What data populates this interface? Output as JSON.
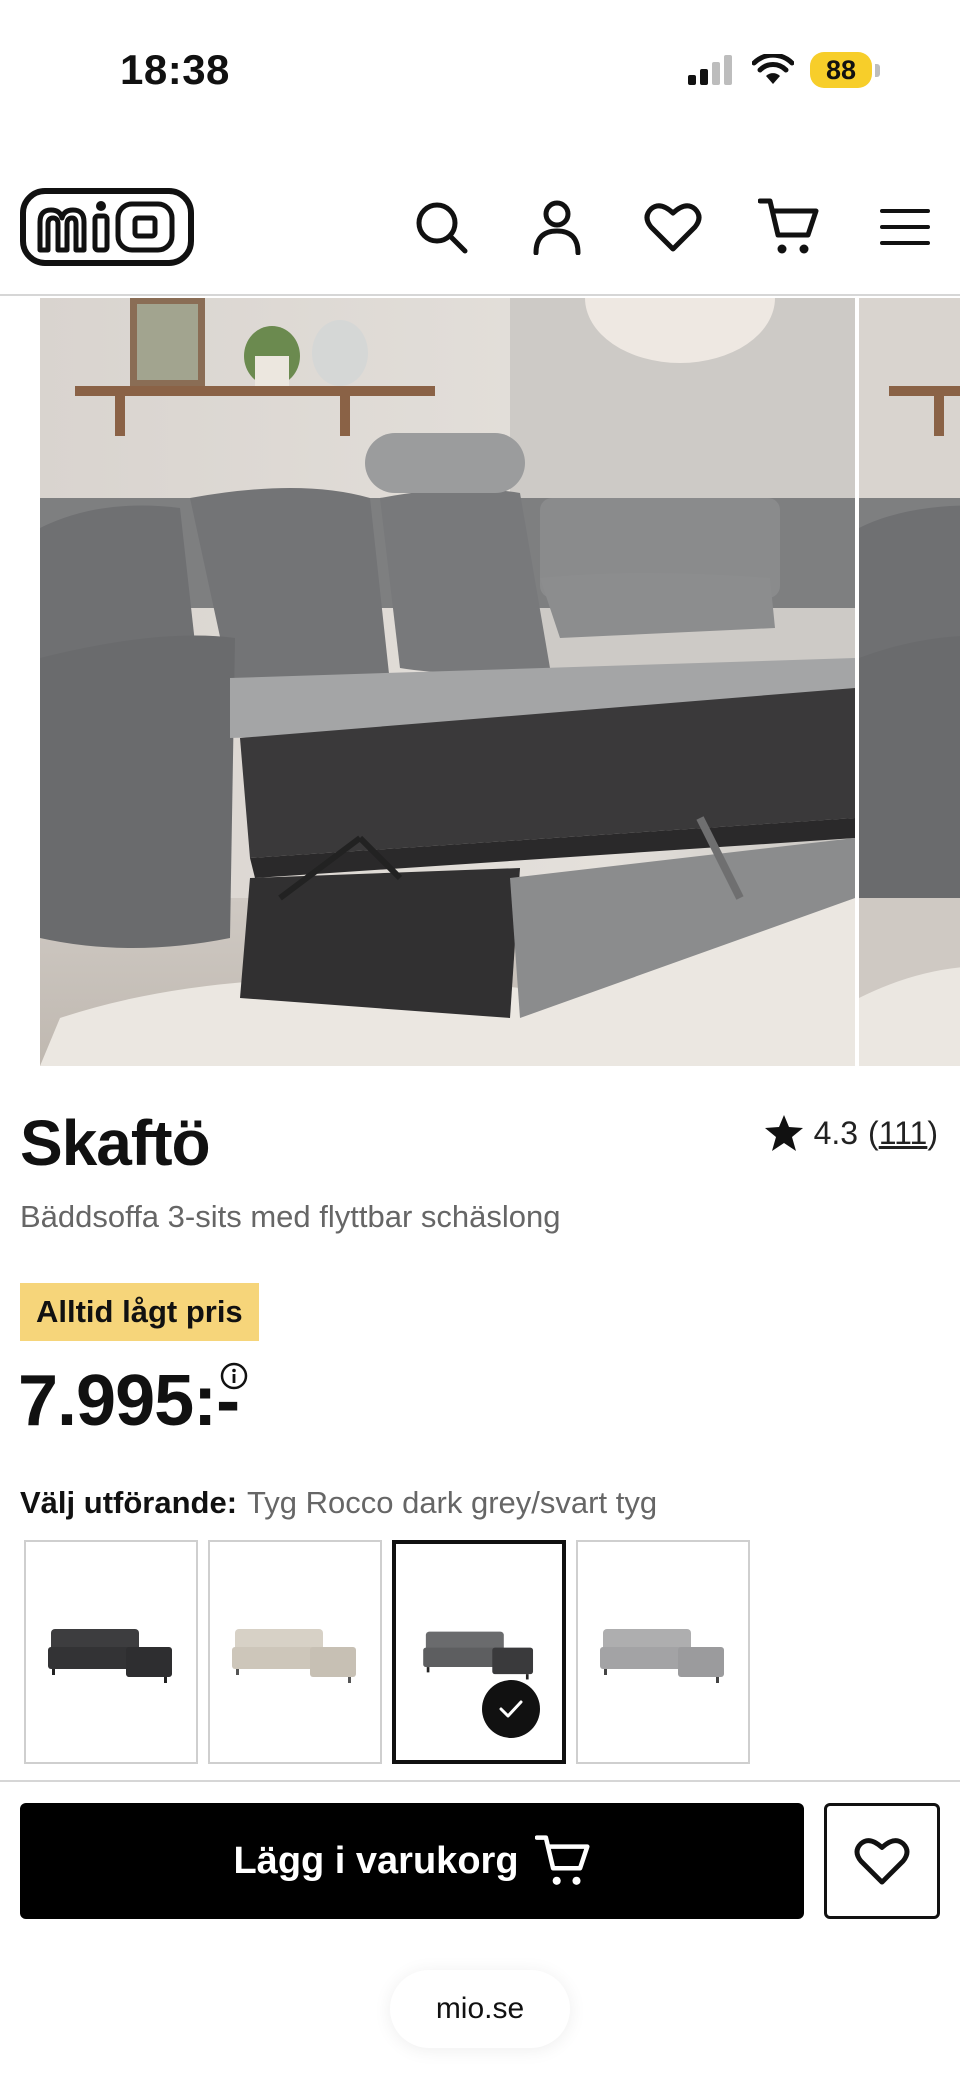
{
  "status_bar": {
    "time": "18:38",
    "battery": "88",
    "icons": [
      "cellular-signal-icon",
      "wifi-icon",
      "battery-icon"
    ]
  },
  "header": {
    "logo_text": "mio",
    "icons": [
      "search-icon",
      "account-icon",
      "heart-icon",
      "cart-icon",
      "menu-icon"
    ]
  },
  "gallery": {
    "images": [
      "grey corner sofa bed with pull-out bed and storage",
      "next product image"
    ]
  },
  "product": {
    "title": "Skaftö",
    "subtitle": "Bäddsoffa 3-sits med flyttbar schäslong",
    "rating": "4.3",
    "rating_count": "111",
    "rating_open": "(",
    "rating_close": ")",
    "price_badge": "Alltid lågt pris",
    "price": "7.995:-",
    "variant_label": "Välj utförande:",
    "variant_value": "Tyg Rocco dark grey/svart tyg",
    "variants": [
      {
        "name": "dark-grey-sofa",
        "selected": false
      },
      {
        "name": "beige-sofa",
        "selected": false
      },
      {
        "name": "dark-grey-black-sofa",
        "selected": true
      },
      {
        "name": "light-grey-sofa",
        "selected": false
      }
    ]
  },
  "actions": {
    "add_to_cart": "Lägg i varukorg"
  },
  "browser": {
    "url": "mio.se"
  },
  "colors": {
    "accent_yellow": "#f6d57a",
    "battery_yellow": "#f7ce2a",
    "primary": "#000000",
    "muted_text": "#666666"
  }
}
